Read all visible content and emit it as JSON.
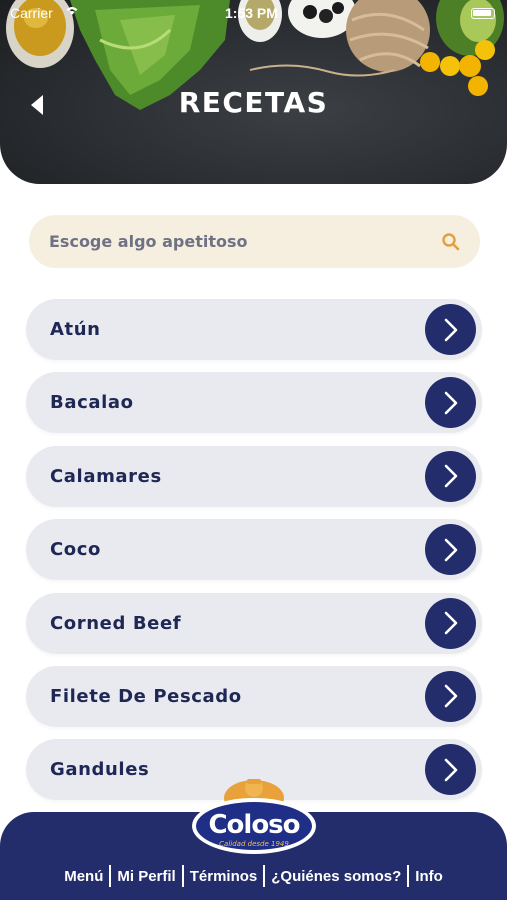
{
  "status_bar": {
    "carrier": "Carrier",
    "time": "1:53 PM"
  },
  "header": {
    "title": "RECETAS",
    "back_icon": "chevron-left-icon"
  },
  "search": {
    "placeholder": "Escoge algo apetitoso",
    "icon": "search-icon",
    "icon_color": "#e0a040"
  },
  "recipes": [
    {
      "label": "Atún"
    },
    {
      "label": "Bacalao"
    },
    {
      "label": "Calamares"
    },
    {
      "label": "Coco"
    },
    {
      "label": "Corned Beef"
    },
    {
      "label": "Filete De Pescado"
    },
    {
      "label": "Gandules"
    }
  ],
  "brand": {
    "name": "Coloso",
    "tagline": "Calidad desde 1949",
    "primary_color": "#232d6b",
    "accent_color": "#f6efdf"
  },
  "footer_nav": {
    "menu": "Menú",
    "profile": "Mi Perfil",
    "terms": "Términos",
    "about": "¿Quiénes somos?",
    "info": "Info"
  }
}
